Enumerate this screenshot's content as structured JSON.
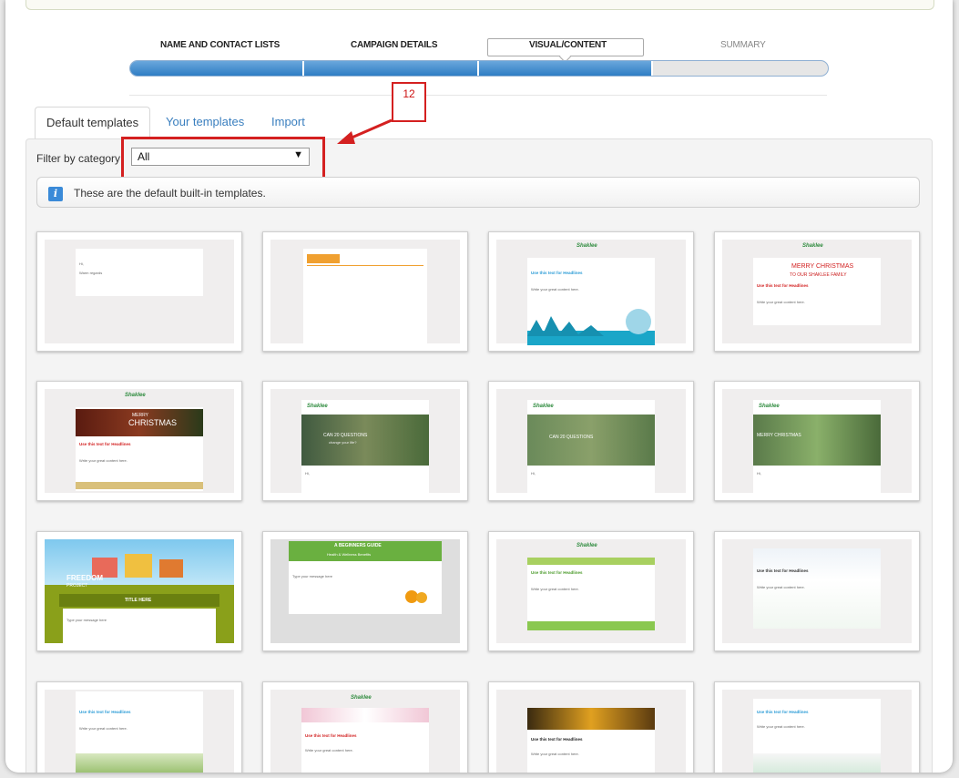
{
  "wizard": {
    "steps": [
      "NAME AND CONTACT LISTS",
      "CAMPAIGN DETAILS",
      "VISUAL/CONTENT",
      "SUMMARY"
    ],
    "progress_completed_steps": 3,
    "progress_total_steps": 4
  },
  "annotation": {
    "number": "12",
    "color": "#d42020"
  },
  "tabs": [
    "Default templates",
    "Your templates",
    "Import"
  ],
  "filter": {
    "label": "Filter by category:",
    "selected": "All"
  },
  "info": {
    "text": "These are the default built-in templates."
  },
  "templates": {
    "shaklee_logo": "Shaklee",
    "headline": "Use this text for Headlines",
    "body": "Write your great content here.",
    "banner_christmas": "MERRY CHRISTMAS",
    "banner_family": "TO OUR SHAKLEE FAMILY",
    "banner_merry": "MERRY",
    "banner_christmas2": "CHRISTMAS",
    "banner_questions": "CAN 20 QUESTIONS",
    "banner_questions_sub": "change your life?",
    "freedom": "FREEDOM",
    "project": "PROJECT",
    "title_here": "TITLE HERE",
    "type_message": "Type your message here",
    "beginners_guide": "A BEGINNERS GUIDE",
    "health_guide": "Health & Wellness Benefits",
    "hi": "Hi,",
    "warm_regards": "Warm regards"
  },
  "colors": {
    "progress": "#2f7dc4",
    "link": "#3a7fbf",
    "highlight": "#d42020"
  }
}
